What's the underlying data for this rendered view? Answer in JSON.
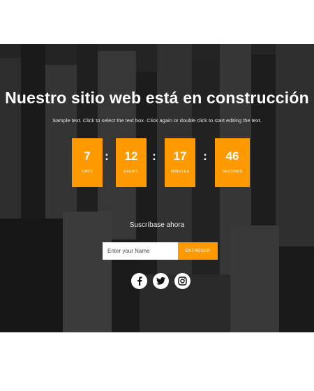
{
  "hero": {
    "title": "Nuestro sitio web está en construcción",
    "subtitle": "Sample text. Click to select the text box. Click again or double click to start editing the text."
  },
  "countdown": [
    {
      "value": "7",
      "label": "DAYS"
    },
    {
      "value": "12",
      "label": "HOURS"
    },
    {
      "value": "17",
      "label": "MINUTES"
    },
    {
      "value": "46",
      "label": "SECONDS"
    }
  ],
  "separator": ":",
  "subscribe": {
    "label": "Suscríbase ahora",
    "input_placeholder": "Enter your Name",
    "button_label": "ENTREGAR"
  },
  "social": [
    "facebook-icon",
    "twitter-icon",
    "instagram-icon"
  ],
  "colors": {
    "accent": "#ff9900",
    "background": "#2a2a2a",
    "text": "#ffffff"
  }
}
